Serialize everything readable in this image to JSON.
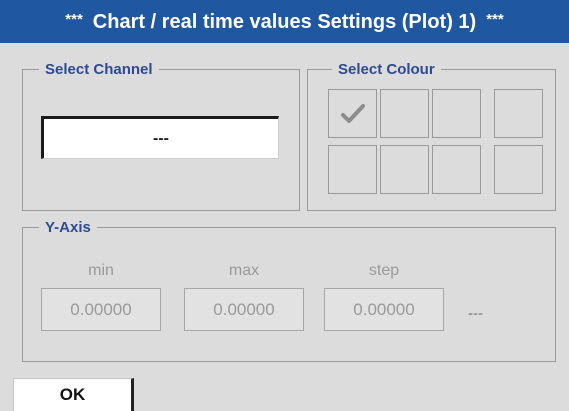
{
  "window": {
    "title": "Chart / real time values Settings (Plot) 1)",
    "title_stars": "***"
  },
  "channel": {
    "legend": "Select Channel",
    "value": "---"
  },
  "colour": {
    "legend": "Select Colour",
    "selected_index": 0,
    "swatch_count": 8,
    "check_icon": "check-icon"
  },
  "yaxis": {
    "legend": "Y-Axis",
    "fields": [
      {
        "label": "min",
        "value": "0.00000"
      },
      {
        "label": "max",
        "value": "0.00000"
      },
      {
        "label": "step",
        "value": "0.00000"
      }
    ],
    "unit": "---"
  },
  "buttons": {
    "ok": "OK"
  },
  "colors": {
    "title_bg": "#1f57a0",
    "legend_text": "#2f4a92",
    "background": "#dcdcdc"
  }
}
